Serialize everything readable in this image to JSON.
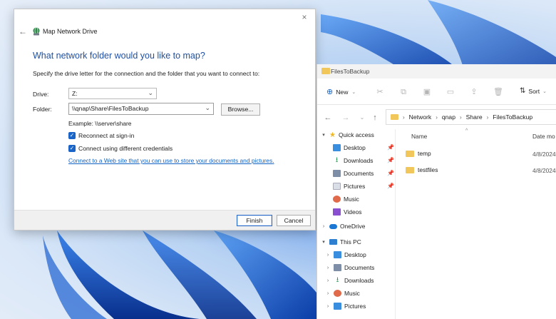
{
  "dialog": {
    "title": "Map Network Drive",
    "close_glyph": "×",
    "back_glyph": "←",
    "heading": "What network folder would you like to map?",
    "description": "Specify the drive letter for the connection and the folder that you want to connect to:",
    "drive_label": "Drive:",
    "drive_value": "Z:",
    "folder_label": "Folder:",
    "folder_value": "\\\\qnap\\Share\\FilesToBackup",
    "browse_label": "Browse...",
    "example_text": "Example: \\\\server\\share",
    "reconnect_label": "Reconnect at sign-in",
    "reconnect_checked": true,
    "different_credentials_label": "Connect using different credentials",
    "different_credentials_checked": true,
    "link_text": "Connect to a Web site that you can use to store your documents and pictures",
    "link_suffix": ".",
    "finish_label": "Finish",
    "cancel_label": "Cancel"
  },
  "explorer": {
    "window_title": "FilesToBackup",
    "toolbar": {
      "new_label": "New",
      "sort_label": "Sort"
    },
    "breadcrumb": [
      "Network",
      "qnap",
      "Share",
      "FilesToBackup"
    ],
    "nav": {
      "quick_access": "Quick access",
      "quick_items": [
        {
          "label": "Desktop",
          "icon": "desktop-icon",
          "color": "#3a8ee0"
        },
        {
          "label": "Downloads",
          "icon": "downloads-icon",
          "color": "#2e9b5b"
        },
        {
          "label": "Documents",
          "icon": "documents-icon",
          "color": "#7d8ea6"
        },
        {
          "label": "Pictures",
          "icon": "pictures-icon",
          "color": "#d9dee7"
        },
        {
          "label": "Music",
          "icon": "music-icon",
          "color": "#e06a4a"
        },
        {
          "label": "Videos",
          "icon": "videos-icon",
          "color": "#8a4fd1"
        }
      ],
      "onedrive": "OneDrive",
      "this_pc": "This PC",
      "pc_items": [
        {
          "label": "Desktop",
          "icon": "desktop-icon",
          "color": "#3a8ee0"
        },
        {
          "label": "Documents",
          "icon": "documents-icon",
          "color": "#7d8ea6"
        },
        {
          "label": "Downloads",
          "icon": "downloads-icon",
          "color": "#2e9b5b"
        },
        {
          "label": "Music",
          "icon": "music-icon",
          "color": "#e06a4a"
        },
        {
          "label": "Pictures",
          "icon": "pictures-icon",
          "color": "#3a8ee0"
        }
      ]
    },
    "columns": {
      "name": "Name",
      "date": "Date mo"
    },
    "files": [
      {
        "name": "temp",
        "date": "4/8/2024"
      },
      {
        "name": "testfiles",
        "date": "4/8/2024"
      }
    ]
  },
  "colors": {
    "accent": "#1a64c8",
    "heading": "#1f4fa3",
    "link": "#1363c4",
    "folder": "#f1c75b"
  }
}
